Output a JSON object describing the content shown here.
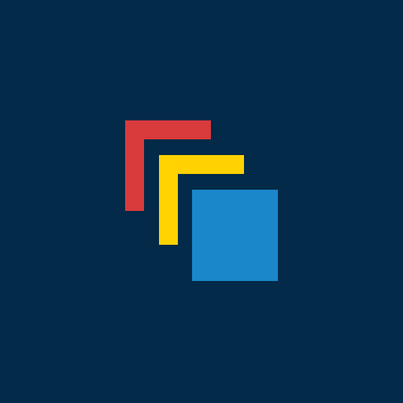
{
  "logo": {
    "name": "stacked-squares-logo",
    "colors": {
      "background": "#032A48",
      "red": "#D93A3B",
      "yellow": "#FFD200",
      "blue": "#1B87CB"
    }
  }
}
